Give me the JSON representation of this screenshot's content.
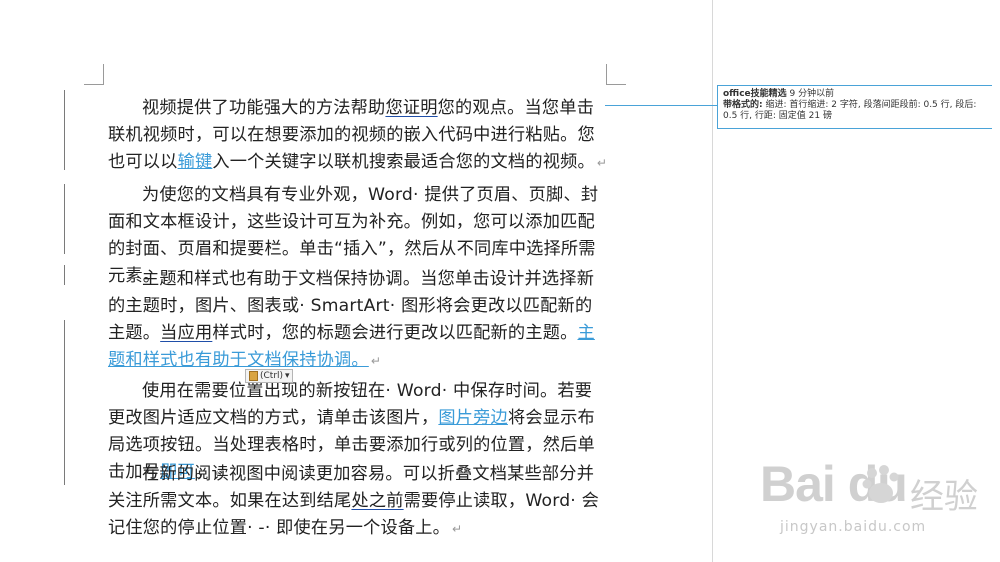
{
  "document": {
    "paragraphs": [
      {
        "segments": [
          {
            "text": "视频提供了功能强大的方法帮助",
            "style": "normal"
          },
          {
            "text": "您证明",
            "style": "wavy"
          },
          {
            "text": "您的观点。当您单击联机视频时，可以在想要添加的视频的嵌入代码中进行粘贴。您也可以以",
            "style": "normal"
          },
          {
            "text": "输键",
            "style": "ins"
          },
          {
            "text": "入一个关键字以联机搜索最适合您的文档的视频。",
            "style": "normal"
          }
        ]
      },
      {
        "segments": [
          {
            "text": "为使您的文档具有专业外观，Word· 提供了页眉、页脚、封面和文本框设计，这些设计可互为补充。例如，您可以添加匹配的封面、页眉和提要栏。单击“插入”，然后从不同库中选择所需元素。",
            "style": "normal"
          }
        ]
      },
      {
        "segments": [
          {
            "text": "主题和样式也有助于文档保持协调。当您单击设计并选择新的主题时，图片、图表或· SmartArt· 图形将会更改以匹配新的主题。",
            "style": "normal"
          },
          {
            "text": "当应用",
            "style": "wavy"
          },
          {
            "text": "样式时，您的标题会进行更改以匹配新的主题。",
            "style": "normal"
          },
          {
            "text": "主题和样式也有助于文档保持协调。",
            "style": "ins"
          }
        ]
      },
      {
        "segments": [
          {
            "text": "使用在需要位置出现的新按钮在· Word· 中保存时间。若要更改图片适应文档的方式，请单击该图片，",
            "style": "normal"
          },
          {
            "text": "图片旁边",
            "style": "ins"
          },
          {
            "text": "将会显示布局选项按钮。当处理表格时，单击要添加行或列的位置，然后单击加号",
            "style": "normal"
          },
          {
            "text": "即可",
            "style": "ins"
          },
          {
            "text": "。",
            "style": "normal"
          }
        ]
      },
      {
        "segments": [
          {
            "text": "在新的阅读视图中阅读更加容易。可以折叠文档某些部分并关注所需文本。如果在达到结尾",
            "style": "normal"
          },
          {
            "text": "处之前",
            "style": "wavy"
          },
          {
            "text": "需要停止读取，Word· 会记住您的停止位置· -· 即使在另一个设备上。",
            "style": "normal"
          }
        ]
      }
    ],
    "paragraph_mark": "↵"
  },
  "paste_options": {
    "label": "(Ctrl)",
    "caret": "▾"
  },
  "comment_balloon": {
    "author": "office技能精选",
    "time": "9 分钟以前",
    "format_label": "带格式的:",
    "format_text": "缩进: 首行缩进: 2 字符, 段落间距段前: 0.5 行, 段后: 0.5 行, 行距: 固定值 21 磅"
  },
  "watermark": {
    "logo_text": "Bai du",
    "cn_text": "经验",
    "url": "jingyan.baidu.com"
  },
  "colors": {
    "insert": "#3a9bd8",
    "balloon_border": "#4aa3d8",
    "text": "#222222"
  }
}
